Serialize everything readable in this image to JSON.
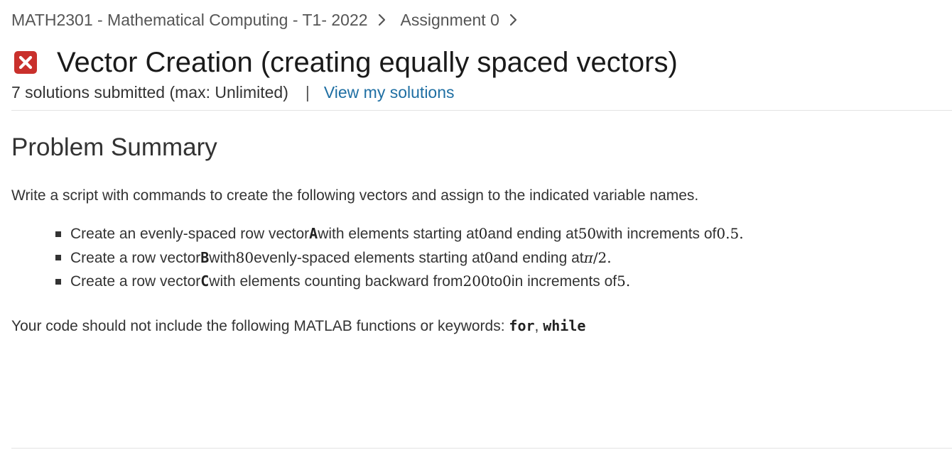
{
  "breadcrumb": {
    "course": "MATH2301 - Mathematical Computing - T1- 2022",
    "assignment": "Assignment 0"
  },
  "problem": {
    "status": "incorrect",
    "title": "Vector Creation (creating equally spaced vectors)",
    "solutions_submitted": "7 solutions submitted (max: Unlimited)",
    "separator": "|",
    "view_solutions_link": "View my solutions"
  },
  "summary": {
    "heading": "Problem Summary",
    "intro": "Write a script with commands to create the following vectors and assign to the indicated variable names.",
    "bullets": [
      {
        "p1": "Create an evenly-spaced row vector ",
        "var": "A",
        "p2": " with elements starting at ",
        "v1": "0",
        "p3": " and ending at ",
        "v2": "50",
        "p4": " with increments of ",
        "v3": "0.5",
        "p5": "."
      },
      {
        "p1": "Create a row vector ",
        "var": "B",
        "p2": " with ",
        "v1": "80",
        "p3": " evenly-spaced elements starting at ",
        "v2": "0",
        "p4": " and ending at ",
        "v3_symbol": "π",
        "v3_rest": "/2",
        "p5": "."
      },
      {
        "p1": "Create a row vector ",
        "var": "C",
        "p2": " with elements counting backward from ",
        "v1": "200",
        "p3": " to ",
        "v2": "0",
        "p4": " in increments of ",
        "v3": "5",
        "p5": "."
      }
    ],
    "restriction_text": "Your code should not include the following MATLAB functions or keywords: ",
    "keywords": [
      "for",
      "while"
    ],
    "keyword_separator": ", "
  },
  "colors": {
    "status_incorrect": "#c9302c",
    "link": "#1f6fa3"
  },
  "icons": {
    "status": "error-x-icon",
    "breadcrumb_separator": "chevron-right-icon"
  }
}
